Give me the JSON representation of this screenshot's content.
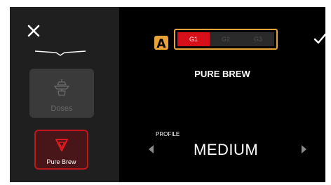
{
  "colors": {
    "screen_bg": "#000000",
    "sidebar_bg": "#1f1f1f",
    "accent_red": "#d5101a",
    "selection_outline": "#e7a23a"
  },
  "sidebar": {
    "close_icon": "close-icon",
    "tiles": [
      {
        "label": "Doses",
        "icon": "doses-icon",
        "state": "disabled"
      },
      {
        "label": "Pure Brew",
        "icon": "pure-brew-icon",
        "state": "selected"
      }
    ]
  },
  "header": {
    "confirm_icon": "checkmark-icon"
  },
  "callout": {
    "letter": "A"
  },
  "grinder_selector": {
    "options": [
      "G1",
      "G2",
      "G3"
    ],
    "selected": "G1"
  },
  "recipe": {
    "title": "PURE BREW"
  },
  "profile": {
    "caption": "PROFILE",
    "value": "MEDIUM"
  }
}
